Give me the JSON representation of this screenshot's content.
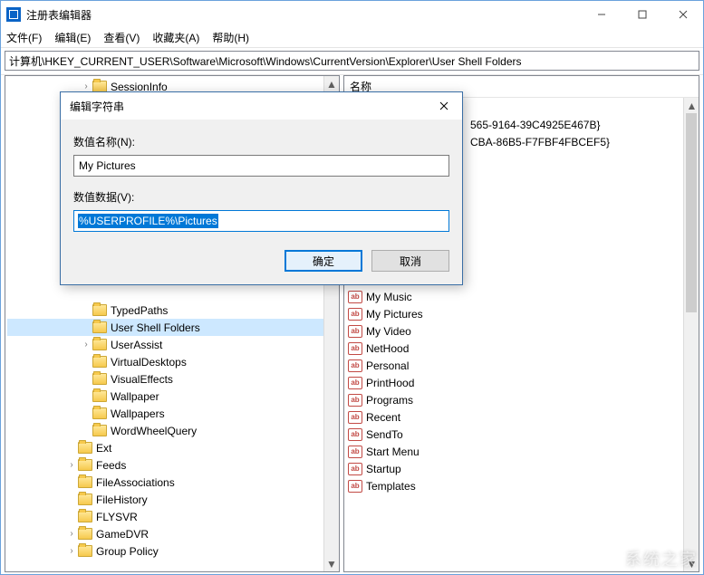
{
  "window": {
    "title": "注册表编辑器"
  },
  "menus": [
    "文件(F)",
    "编辑(E)",
    "查看(V)",
    "收藏夹(A)",
    "帮助(H)"
  ],
  "address": "计算机\\HKEY_CURRENT_USER\\Software\\Microsoft\\Windows\\CurrentVersion\\Explorer\\User Shell Folders",
  "tree": {
    "visible": [
      {
        "depth": 5,
        "arrow": ">",
        "label": "SessionInfo"
      },
      {
        "depth": 5,
        "arrow": "",
        "label": "TypedPaths"
      },
      {
        "depth": 5,
        "arrow": "",
        "label": "User Shell Folders",
        "selected": true
      },
      {
        "depth": 5,
        "arrow": ">",
        "label": "UserAssist"
      },
      {
        "depth": 5,
        "arrow": "",
        "label": "VirtualDesktops"
      },
      {
        "depth": 5,
        "arrow": "",
        "label": "VisualEffects"
      },
      {
        "depth": 5,
        "arrow": "",
        "label": "Wallpaper"
      },
      {
        "depth": 5,
        "arrow": "",
        "label": "Wallpapers"
      },
      {
        "depth": 5,
        "arrow": "",
        "label": "WordWheelQuery"
      },
      {
        "depth": 4,
        "arrow": "",
        "label": "Ext"
      },
      {
        "depth": 4,
        "arrow": ">",
        "label": "Feeds"
      },
      {
        "depth": 4,
        "arrow": "",
        "label": "FileAssociations"
      },
      {
        "depth": 4,
        "arrow": "",
        "label": "FileHistory"
      },
      {
        "depth": 4,
        "arrow": "",
        "label": "FLYSVR"
      },
      {
        "depth": 4,
        "arrow": ">",
        "label": "GameDVR"
      },
      {
        "depth": 4,
        "arrow": ">",
        "label": "Group Policy"
      }
    ]
  },
  "list": {
    "header": "名称",
    "rows_partial": [
      "565-9164-39C4925E467B}",
      "CBA-86B5-F7FBF4FBCEF5}"
    ],
    "rows": [
      "My Music",
      "My Pictures",
      "My Video",
      "NetHood",
      "Personal",
      "PrintHood",
      "Programs",
      "Recent",
      "SendTo",
      "Start Menu",
      "Startup",
      "Templates"
    ]
  },
  "dialog": {
    "title": "编辑字符串",
    "name_label": "数值名称(N):",
    "name_value": "My Pictures",
    "data_label": "数值数据(V):",
    "data_value": "%USERPROFILE%\\Pictures",
    "ok": "确定",
    "cancel": "取消"
  },
  "watermark": "系统之家"
}
